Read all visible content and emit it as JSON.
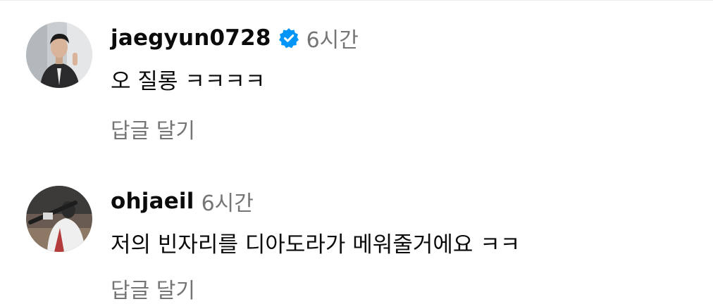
{
  "comments": [
    {
      "username": "jaegyun0728",
      "verified": true,
      "time": "6시간",
      "text": "오 질롱 ㅋㅋㅋㅋ",
      "reply_label": "답글 달기",
      "avatar_icon": "profile-photo"
    },
    {
      "username": "ohjaeil",
      "verified": false,
      "time": "6시간",
      "text": "저의 빈자리를 디아도라가 메워줄거에요 ㅋㅋ",
      "reply_label": "답글 달기",
      "avatar_icon": "profile-photo"
    }
  ],
  "colors": {
    "text": "#0b0b0b",
    "secondary": "#757575",
    "verified_badge": "#0095f6"
  }
}
